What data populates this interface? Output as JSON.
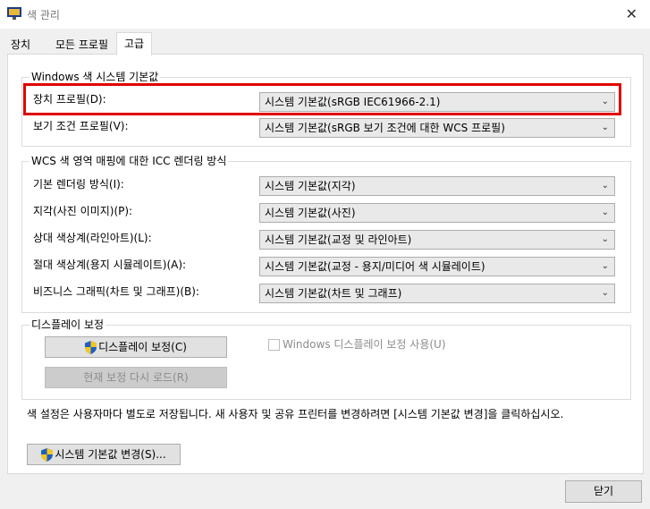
{
  "window": {
    "title": "색 관리"
  },
  "tabs": [
    {
      "label": "장치"
    },
    {
      "label": "모든 프로필"
    },
    {
      "label": "고급"
    }
  ],
  "windows_defaults": {
    "group_title": "Windows 색 시스템 기본값",
    "device_profile": {
      "label": "장치 프로필(D):",
      "value": "시스템 기본값(sRGB IEC61966-2.1)"
    },
    "viewing_profile": {
      "label": "보기 조건 프로필(V):",
      "value": "시스템 기본값(sRGB 보기 조건에 대한 WCS 프로필)"
    }
  },
  "icc_rendering": {
    "group_title": "WCS 색 영역 매핑에 대한 ICC 렌더링 방식",
    "rows": [
      {
        "label": "기본 렌더링 방식(I):",
        "value": "시스템 기본값(지각)"
      },
      {
        "label": "지각(사진 이미지)(P):",
        "value": "시스템 기본값(사진)"
      },
      {
        "label": "상대 색상계(라인아트)(L):",
        "value": "시스템 기본값(교정 및 라인아트)"
      },
      {
        "label": "절대 색상계(용지 시뮬레이트)(A):",
        "value": "시스템 기본값(교정 - 용지/미디어 색 시뮬레이트)"
      },
      {
        "label": "비즈니스 그래픽(차트 및 그래프)(B):",
        "value": "시스템 기본값(차트 및 그래프)"
      }
    ]
  },
  "display_calibration": {
    "group_title": "디스플레이 보정",
    "calibrate_button": "디스플레이 보정(C)",
    "reload_button": "현재 보정 다시 로드(R)",
    "checkbox_label": "Windows 디스플레이 보정 사용(U)"
  },
  "footer_note": "색 설정은 사용자마다 별도로 저장됩니다. 새 사용자 및 공유 프린터를 변경하려면 [시스템 기본값 변경]을 클릭하십시오.",
  "change_defaults_button": "시스템 기본값 변경(S)...",
  "close_button": "닫기",
  "colors": {
    "highlight": "#e00000",
    "shield_blue": "#1f5fbf",
    "shield_yellow": "#f3c623"
  }
}
